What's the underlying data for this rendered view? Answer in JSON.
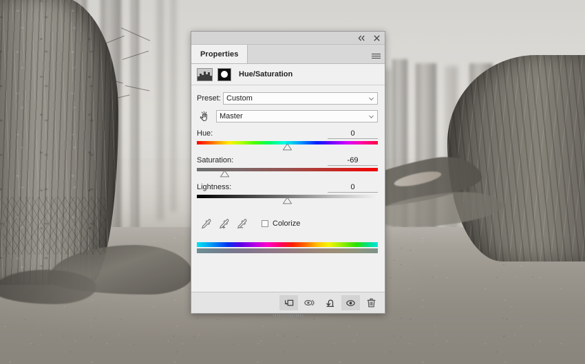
{
  "panel": {
    "tab_label": "Properties",
    "titlebar": {
      "collapse_icon": "double-chevron-left-icon",
      "close_icon": "close-icon"
    },
    "menu_icon": "panel-menu-icon",
    "adjustment": {
      "icon": "hue-saturation-adjustment-icon",
      "mask_icon": "layer-mask-thumbnail",
      "title": "Hue/Saturation"
    },
    "preset": {
      "label": "Preset:",
      "value": "Custom",
      "caret_icon": "chevron-down-icon"
    },
    "channel": {
      "scrub_icon": "on-image-adjustment-hand-icon",
      "value": "Master",
      "caret_icon": "chevron-down-icon"
    },
    "sliders": [
      {
        "name": "Hue:",
        "value": "0",
        "thumb_pct": 50.0,
        "gradient": "g-hue"
      },
      {
        "name": "Saturation:",
        "value": "-69",
        "thumb_pct": 15.5,
        "gradient": "g-sat"
      },
      {
        "name": "Lightness:",
        "value": "0",
        "thumb_pct": 50.0,
        "gradient": "g-light"
      }
    ],
    "eyedroppers": [
      {
        "icon": "eyedropper-icon",
        "sign": ""
      },
      {
        "icon": "eyedropper-add-icon",
        "sign": "+"
      },
      {
        "icon": "eyedropper-subtract-icon",
        "sign": "−"
      }
    ],
    "colorize": {
      "label": "Colorize",
      "checked": false
    },
    "footer_buttons": [
      {
        "name": "clip-to-layer-button",
        "icon": "clip-to-layer-icon",
        "active": true
      },
      {
        "name": "view-previous-state-button",
        "icon": "eye-previous-state-icon",
        "active": false
      },
      {
        "name": "reset-button",
        "icon": "reset-arrow-icon",
        "active": false
      },
      {
        "name": "toggle-visibility-button",
        "icon": "eye-icon",
        "active": true
      },
      {
        "name": "delete-button",
        "icon": "trash-icon",
        "active": false
      }
    ],
    "resize_grip_icon": "resize-grip-icon"
  },
  "canvas": {
    "scene": "foggy-forest-photo",
    "accent": "#f0f0f0"
  }
}
